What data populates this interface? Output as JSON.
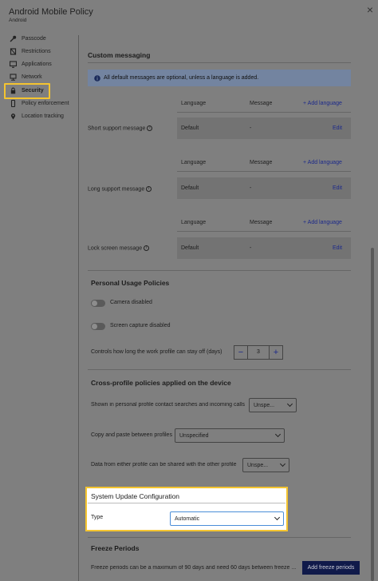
{
  "header": {
    "title": "Android Mobile Policy",
    "subtitle": "Android"
  },
  "sidebar": {
    "items": [
      {
        "label": "Passcode",
        "icon": "key-icon"
      },
      {
        "label": "Restrictions",
        "icon": "restrictions-icon"
      },
      {
        "label": "Applications",
        "icon": "monitor-icon"
      },
      {
        "label": "Network",
        "icon": "network-icon"
      },
      {
        "label": "Security",
        "icon": "lock-icon",
        "active": true
      },
      {
        "label": "Policy enforcement",
        "icon": "phone-icon"
      },
      {
        "label": "Location tracking",
        "icon": "location-pin-icon"
      }
    ]
  },
  "custom_messaging": {
    "title": "Custom messaging",
    "info": "All default messages are optional, unless a language is added.",
    "col_language": "Language",
    "col_message": "Message",
    "add_language": "Add language",
    "edit": "Edit",
    "rows": [
      {
        "label": "Short support message",
        "language": "Default",
        "message": "-"
      },
      {
        "label": "Long support message",
        "language": "Default",
        "message": "-"
      },
      {
        "label": "Lock screen message",
        "language": "Default",
        "message": "-"
      }
    ]
  },
  "personal_usage": {
    "title": "Personal Usage Policies",
    "camera": "Camera disabled",
    "screen_capture": "Screen capture disabled",
    "work_profile_off": "Controls how long the work profile can stay off (days)",
    "stepper_minus": "−",
    "stepper_value": "3",
    "stepper_plus": "+"
  },
  "cross_profile": {
    "title": "Cross-profile policies applied on the device",
    "contact_search": "Shown in personal profile contact searches and incoming calls",
    "contact_search_value": "Unspe...",
    "copy_paste": "Copy and paste between profiles",
    "copy_paste_value": "Unspecified",
    "data_share": "Data from either profile can be shared with the other profile",
    "data_share_value": "Unspe..."
  },
  "system_update": {
    "title": "System Update Configuration",
    "type_label": "Type",
    "type_value": "Automatic"
  },
  "freeze_periods": {
    "title": "Freeze Periods",
    "description": "Freeze periods can be a maximum of 90 days and need 60 days between freeze ...",
    "add_button": "Add freeze periods"
  },
  "colors": {
    "highlight": "#f4c430",
    "link": "#1d2a8a",
    "primary_button": "#101a4a",
    "overlay": "#7f7f7f"
  }
}
